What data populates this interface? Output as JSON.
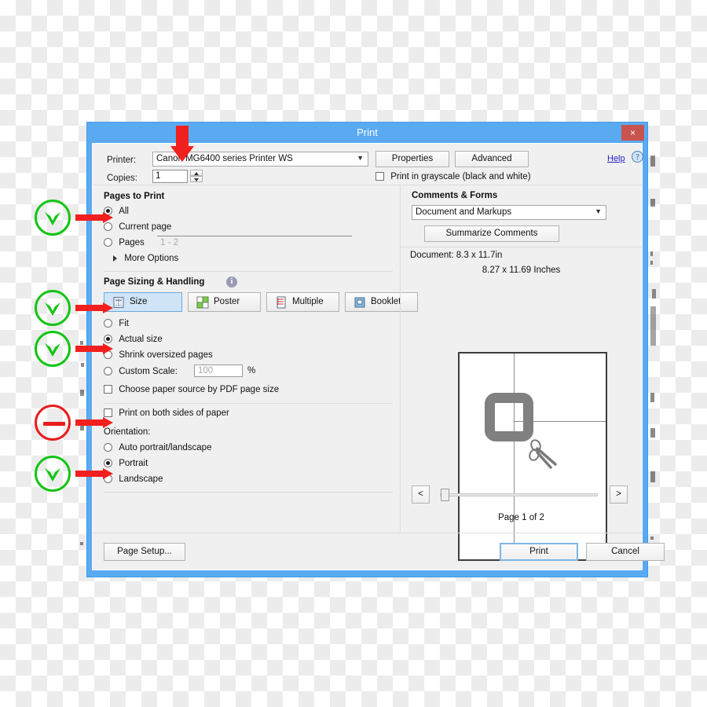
{
  "dialog": {
    "title": "Print",
    "close_label": "×"
  },
  "printer": {
    "label": "Printer:",
    "value": "Canon MG6400 series Printer WS",
    "properties_label": "Properties",
    "advanced_label": "Advanced",
    "help_label": "Help",
    "help_icon_glyph": "?",
    "copies_label": "Copies:",
    "copies_value": "1",
    "grayscale_label": "Print in grayscale (black and white)"
  },
  "pages_to_print": {
    "title": "Pages to Print",
    "options": [
      {
        "label": "All",
        "selected": true
      },
      {
        "label": "Current page",
        "selected": false
      },
      {
        "label": "Pages",
        "selected": false
      }
    ],
    "pages_placeholder": "1 - 2",
    "more_options_label": "More Options"
  },
  "page_sizing": {
    "title": "Page Sizing & Handling",
    "info_glyph": "i",
    "tabs": [
      {
        "label": "Size",
        "icon": "size-icon",
        "selected": true
      },
      {
        "label": "Poster",
        "icon": "poster-icon",
        "selected": false
      },
      {
        "label": "Multiple",
        "icon": "multiple-icon",
        "selected": false
      },
      {
        "label": "Booklet",
        "icon": "booklet-icon",
        "selected": false
      }
    ],
    "options": [
      {
        "label": "Fit",
        "selected": false
      },
      {
        "label": "Actual size",
        "selected": true
      },
      {
        "label": "Shrink oversized pages",
        "selected": false
      },
      {
        "label": "Custom Scale:",
        "selected": false
      }
    ],
    "custom_scale_value": "100",
    "percent_label": "%",
    "paper_source_label": "Choose paper source by PDF page size",
    "paper_source_checked": false,
    "both_sides_label": "Print on both sides of paper",
    "both_sides_checked": false
  },
  "orientation": {
    "title": "Orientation:",
    "options": [
      {
        "label": "Auto portrait/landscape",
        "selected": false
      },
      {
        "label": "Portrait",
        "selected": true
      },
      {
        "label": "Landscape",
        "selected": false
      }
    ]
  },
  "comments_forms": {
    "title": "Comments & Forms",
    "value": "Document and Markups",
    "summarize_label": "Summarize Comments"
  },
  "preview": {
    "document_info": "Document: 8.3 x 11.7in",
    "page_size": "8.27 x 11.69 Inches",
    "prev_label": "<",
    "next_label": ">",
    "page_status": "Page 1 of 2"
  },
  "footer": {
    "page_setup_label": "Page Setup...",
    "print_label": "Print",
    "cancel_label": "Cancel"
  },
  "colors": {
    "title_bar": "#5aaaf2",
    "close_button": "#c9534f",
    "annotation_green": "#14c414",
    "annotation_red": "#e81c1c",
    "arrow_red": "#f21f1f",
    "selected_tab": "#cfe5f7",
    "link": "#2222cc"
  },
  "annotations": [
    {
      "type": "check-circle",
      "target": "All"
    },
    {
      "type": "check-circle",
      "target": "Size"
    },
    {
      "type": "check-circle",
      "target": "Actual size"
    },
    {
      "type": "minus-circle",
      "target": "Print on both sides of paper"
    },
    {
      "type": "check-circle",
      "target": "Portrait"
    },
    {
      "type": "down-arrow",
      "target": "Printer:"
    }
  ]
}
